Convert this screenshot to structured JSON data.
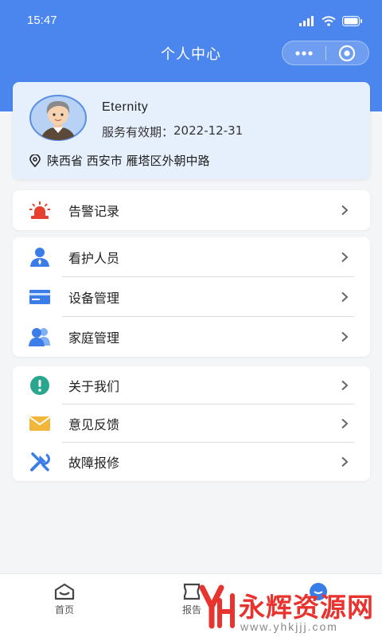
{
  "status_bar": {
    "time": "15:47",
    "icons": [
      "signal-icon",
      "wifi-icon",
      "battery-icon"
    ]
  },
  "nav": {
    "title": "个人中心",
    "capsule_icons": [
      "more-dots-icon",
      "close-circle-icon"
    ]
  },
  "profile": {
    "name": "Eternity",
    "expiry_label": "服务有效期：",
    "expiry_date": "2022-12-31",
    "address": "陕西省 西安市 雁塔区外朝中路"
  },
  "menu_groups": [
    [
      {
        "label": "告警记录",
        "icon": "alarm-icon",
        "color": "#e8402f"
      }
    ],
    [
      {
        "label": "看护人员",
        "icon": "caregiver-icon",
        "color": "#3b7de8"
      },
      {
        "label": "设备管理",
        "icon": "device-card-icon",
        "color": "#3b7de8"
      },
      {
        "label": "家庭管理",
        "icon": "family-icon",
        "color": "#3b7de8"
      }
    ],
    [
      {
        "label": "关于我们",
        "icon": "info-exclamation-icon",
        "color": "#2aa68f"
      },
      {
        "label": "意见反馈",
        "icon": "envelope-icon",
        "color": "#f2b63a"
      },
      {
        "label": "故障报修",
        "icon": "repair-tools-icon",
        "color": "#3b7de8"
      }
    ]
  ],
  "tab_bar": {
    "home_label": "首页",
    "report_label": "报告",
    "active_color": "#3b7de8"
  },
  "watermark": {
    "text": "永辉资源网",
    "url": "www.yhkjjj.com"
  },
  "colors": {
    "primary": "#4b86ee",
    "card_bg": "#e6f0fd",
    "page_bg": "#f4f5f7"
  }
}
